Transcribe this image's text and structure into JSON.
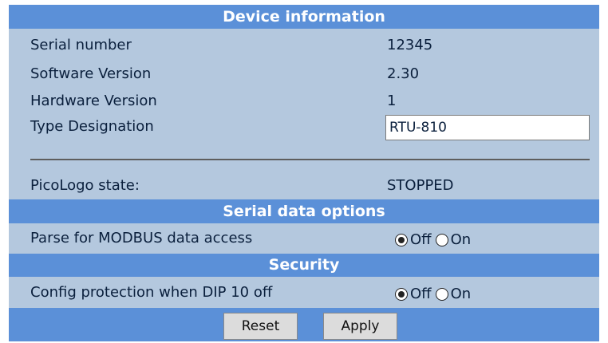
{
  "device_info": {
    "header": "Device information",
    "rows": [
      {
        "label": "Serial number",
        "value": "12345"
      },
      {
        "label": "Software Version",
        "value": "2.30"
      },
      {
        "label": "Hardware Version",
        "value": "1"
      }
    ],
    "type_designation": {
      "label": "Type Designation",
      "value": "RTU-810"
    },
    "picologo_state": {
      "label": "PicoLogo state:",
      "value": "STOPPED"
    }
  },
  "serial_options": {
    "header": "Serial data options",
    "modbus": {
      "label": "Parse for MODBUS data access",
      "selected": "Off",
      "off_label": "Off",
      "on_label": "On"
    }
  },
  "security": {
    "header": "Security",
    "config_protection": {
      "label": "Config protection when DIP 10 off",
      "selected": "Off",
      "off_label": "Off",
      "on_label": "On"
    }
  },
  "buttons": {
    "reset": "Reset",
    "apply": "Apply"
  },
  "colors": {
    "header_bg": "#5b90d8",
    "panel_bg": "#b4c8de",
    "text": "#0a1f3c"
  }
}
